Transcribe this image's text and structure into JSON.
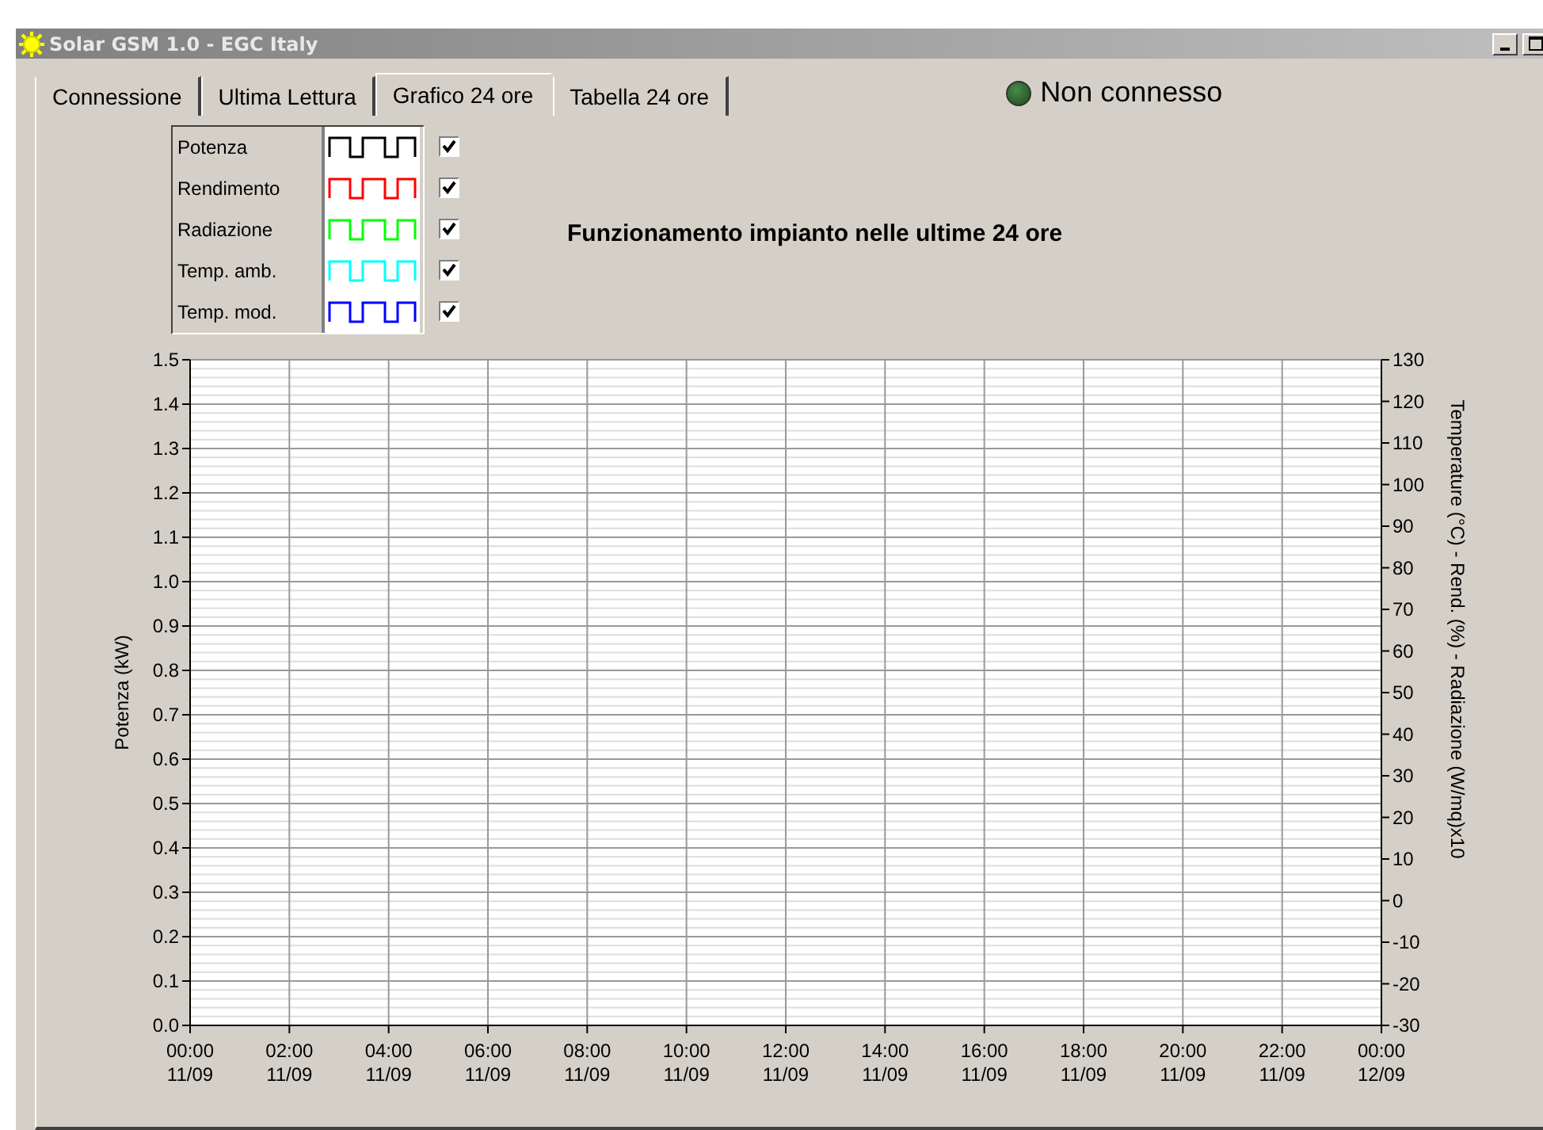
{
  "window": {
    "title": "Solar GSM 1.0 - EGC Italy"
  },
  "tabs": [
    {
      "label": "Connessione",
      "selected": false
    },
    {
      "label": "Ultima Lettura",
      "selected": false
    },
    {
      "label": "Grafico 24 ore",
      "selected": true
    },
    {
      "label": "Tabella 24 ore",
      "selected": false
    }
  ],
  "status": {
    "connected": false,
    "text": "Non connesso"
  },
  "legend": [
    {
      "name": "Potenza",
      "color": "#000000",
      "checked": true
    },
    {
      "name": "Rendimento",
      "color": "#ff0000",
      "checked": true
    },
    {
      "name": "Radiazione",
      "color": "#00ff00",
      "checked": true
    },
    {
      "name": "Temp. amb.",
      "color": "#00ffff",
      "checked": true
    },
    {
      "name": "Temp. mod.",
      "color": "#0000ff",
      "checked": true
    }
  ],
  "chart": {
    "chart_data": {
      "type": "line",
      "title": "Funzionamento impianto nelle ultime 24 ore",
      "ylabel": "Potenza (kW)",
      "ylim": [
        0,
        1.5
      ],
      "yticks": [
        {
          "value": 0,
          "label": "0.0"
        },
        {
          "value": 0.1,
          "label": "0.1"
        },
        {
          "value": 0.2,
          "label": "0.2"
        },
        {
          "value": 0.3,
          "label": "0.3"
        },
        {
          "value": 0.4,
          "label": "0.4"
        },
        {
          "value": 0.5,
          "label": "0.5"
        },
        {
          "value": 0.6,
          "label": "0.6"
        },
        {
          "value": 0.7,
          "label": "0.7"
        },
        {
          "value": 0.8,
          "label": "0.8"
        },
        {
          "value": 0.9,
          "label": "0.9"
        },
        {
          "value": 1.0,
          "label": "1.0"
        },
        {
          "value": 1.1,
          "label": "1.1"
        },
        {
          "value": 1.2,
          "label": "1.2"
        },
        {
          "value": 1.3,
          "label": "1.3"
        },
        {
          "value": 1.4,
          "label": "1.4"
        },
        {
          "value": 1.5,
          "label": "1.5"
        }
      ],
      "grid": true,
      "categories": [
        "00:00 11/09",
        "02:00 11/09",
        "04:00 11/09",
        "06:00 11/09",
        "08:00 11/09",
        "10:00 11/09",
        "12:00 11/09",
        "14:00 11/09",
        "16:00 11/09",
        "18:00 11/09",
        "20:00 11/09",
        "22:00 11/09",
        "00:00 12/09"
      ]
    },
    "right_axis": {
      "label": "Temperature (°C) - Rend. (%) - Radiazione (W/mq)x10",
      "ticks": [
        "130",
        "120",
        "110",
        "100",
        "90",
        "80",
        "70",
        "60",
        "50",
        "40",
        "30",
        "20",
        "10",
        "0",
        "-10",
        "-20",
        "-30"
      ]
    }
  }
}
